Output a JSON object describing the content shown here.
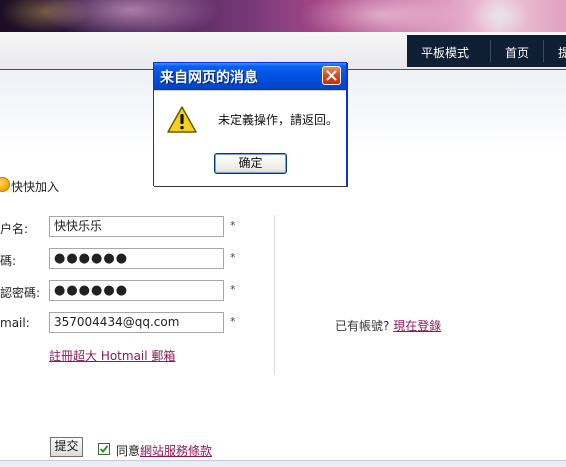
{
  "nav": {
    "items": [
      {
        "label": "平板模式"
      },
      {
        "label": "首页"
      },
      {
        "label": "提"
      }
    ]
  },
  "quick_join": {
    "label": "快快加入",
    "icon": "smile-icon"
  },
  "form": {
    "username": {
      "label": "户名:",
      "value": "快快乐乐"
    },
    "password": {
      "label": "碼:",
      "value": "●●●●●●"
    },
    "confirm_password": {
      "label": "認密碼:",
      "value": "●●●●●●"
    },
    "email": {
      "label": "mail:",
      "value": "357004434@qq.com"
    },
    "required_mark": "*",
    "hotmail_link": "註冊超大 Hotmail 郵箱",
    "submit_label": "提交",
    "agree": {
      "checked": true,
      "prefix": "同意",
      "terms_link": "網站服務條款"
    }
  },
  "account": {
    "prompt": "已有帳號?",
    "login_link": "現在登錄"
  },
  "dialog": {
    "title": "来自网页的消息",
    "message": "未定義操作，請返回。",
    "ok_label": "确定",
    "icon": "warning-icon"
  },
  "colors": {
    "nav_bg": "#0f1f33",
    "accent_red": "#b2222e",
    "link": "#8b1a5a",
    "dialog_title": "#0052e0"
  }
}
